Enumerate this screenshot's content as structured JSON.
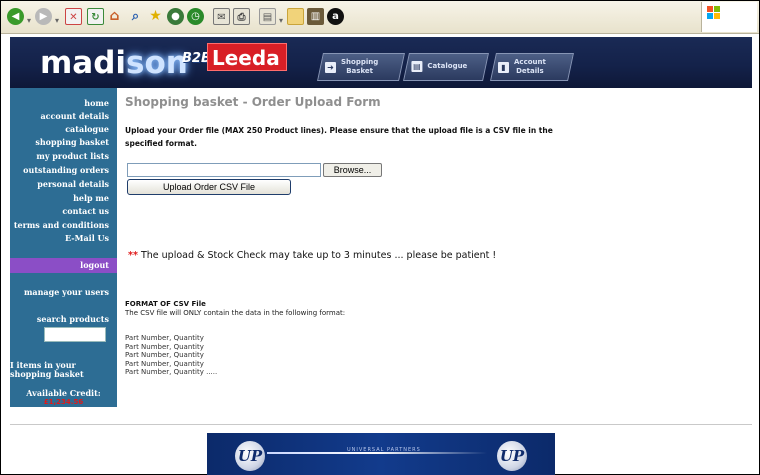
{
  "colors": {
    "header_bg": "#14224a",
    "sidebar_bg": "#2d6d94",
    "logout_bg": "#8b4ec6",
    "accent_red": "#d81f26",
    "title_gray": "#8f8f8f"
  },
  "toolbar": {
    "icons": [
      "back-icon",
      "forward-icon",
      "stop-icon",
      "refresh-icon",
      "home-icon",
      "search-icon",
      "favorites-icon",
      "media-icon",
      "history-icon",
      "mail-icon",
      "print-icon",
      "edit-icon",
      "folder-icon",
      "research-icon",
      "messenger-icon"
    ]
  },
  "header": {
    "logo_main": "madi",
    "logo_glow": "son",
    "logo_b2b": "B2B",
    "logo_leeda": "Leeda",
    "nav": [
      {
        "label1": "Shopping",
        "label2": "Basket"
      },
      {
        "label1": "Catalogue",
        "label2": ""
      },
      {
        "label1": "Account",
        "label2": "Details"
      }
    ]
  },
  "sidebar": {
    "links": [
      "home",
      "account details",
      "catalogue",
      "shopping basket",
      "my product lists",
      "outstanding orders",
      "personal details",
      "help me",
      "contact us",
      "terms and conditions",
      "E-Mail Us"
    ],
    "logout": "logout",
    "manage_users": "manage your users",
    "search_products": "search products",
    "basket_note": "I items in your shopping basket",
    "credit_label": "Available Credit:",
    "credit_value": "£1,234.56"
  },
  "main": {
    "title": "Shopping basket - Order Upload Form",
    "intro": "Upload your Order file (MAX 250 Product lines). Please ensure that the upload file is a CSV file in the specified format.",
    "file_value": "",
    "browse_label": "Browse...",
    "upload_label": "Upload Order CSV File",
    "notice_stars": "**",
    "notice_text": "The upload & Stock Check may take up to 3 minutes ... please be patient !",
    "format_title": "FORMAT OF CSV File",
    "format_desc": "The CSV file will ONLY contain the data in the following format:",
    "format_lines": [
      "Part Number, Quantity",
      "Part Number, Quantity",
      "Part Number, Quantity",
      "Part Number, Quantity",
      "Part Number, Quantity ....."
    ]
  },
  "footer": {
    "logo_text": "UP",
    "banner_text": "UNIVERSAL PARTNERS"
  }
}
